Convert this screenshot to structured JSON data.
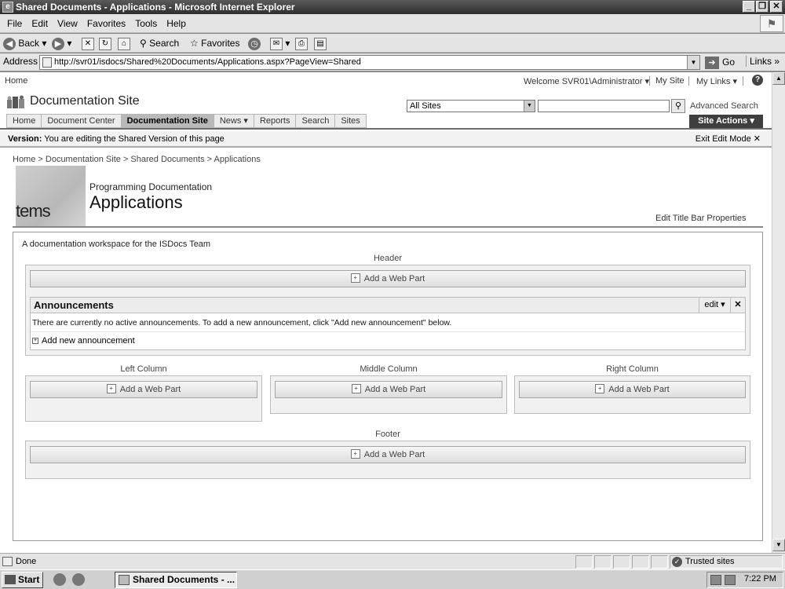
{
  "window": {
    "title": "Shared Documents - Applications - Microsoft Internet Explorer"
  },
  "menu": [
    "File",
    "Edit",
    "View",
    "Favorites",
    "Tools",
    "Help"
  ],
  "toolbar": {
    "back": "Back",
    "search": "Search",
    "favorites": "Favorites"
  },
  "address": {
    "label": "Address",
    "url": "http://svr01/isdocs/Shared%20Documents/Applications.aspx?PageView=Shared",
    "go": "Go",
    "links": "Links"
  },
  "sharepoint": {
    "home_link": "Home",
    "welcome": "Welcome SVR01\\Administrator ▾",
    "my_site": "My Site",
    "my_links": "My Links ▾",
    "site_title": "Documentation Site",
    "search_scope": "All Sites",
    "advanced_search": "Advanced Search",
    "tabs": [
      "Home",
      "Document Center",
      "Documentation Site",
      "News ▾",
      "Reports",
      "Search",
      "Sites"
    ],
    "active_tab": 2,
    "site_actions": "Site Actions ▾",
    "version_label": "Version:",
    "version_text": "You are editing the Shared Version of this page",
    "exit_edit": "Exit Edit Mode ✕",
    "breadcrumb": "Home > Documentation Site > Shared Documents > Applications",
    "title_image_text": "tems",
    "subtitle": "Programming Documentation",
    "page_title": "Applications",
    "edit_title_bar": "Edit Title Bar Properties",
    "description": "A documentation workspace for the ISDocs Team"
  },
  "zones": {
    "header": "Header",
    "left": "Left Column",
    "middle": "Middle Column",
    "right": "Right Column",
    "footer": "Footer",
    "add_web_part": "Add a Web Part"
  },
  "announcements": {
    "title": "Announcements",
    "edit": "edit ▾",
    "close": "✕",
    "body": "There are currently no active announcements. To add a new announcement, click \"Add new announcement\" below.",
    "add": "Add new announcement"
  },
  "status": {
    "text": "Done",
    "zone": "Trusted sites"
  },
  "taskbar": {
    "start": "Start",
    "task": "Shared Documents - ...",
    "clock": "7:22 PM"
  }
}
